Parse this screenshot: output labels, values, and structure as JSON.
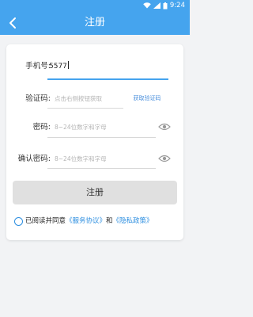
{
  "status": {
    "time": "9:24"
  },
  "header": {
    "title": "注册"
  },
  "form": {
    "phone": {
      "label": "手机号:",
      "value": "5577"
    },
    "code": {
      "label": "验证码:",
      "placeholder": "点击右侧按钮获取",
      "button": "获取验证码"
    },
    "password": {
      "label": "密码:",
      "placeholder": "8~24位数字和字母"
    },
    "confirm": {
      "label": "确认密码:",
      "placeholder": "8~24位数字和字母"
    },
    "submit": "注册"
  },
  "agreement": {
    "prefix": "已阅读并同意",
    "service": "《服务协议》",
    "and": "和",
    "privacy": "《隐私政策》"
  },
  "colors": {
    "primary": "#45a4ee",
    "link": "#2e8fe0",
    "button_bg": "#e0e0e0",
    "background": "#f2f3f5"
  }
}
